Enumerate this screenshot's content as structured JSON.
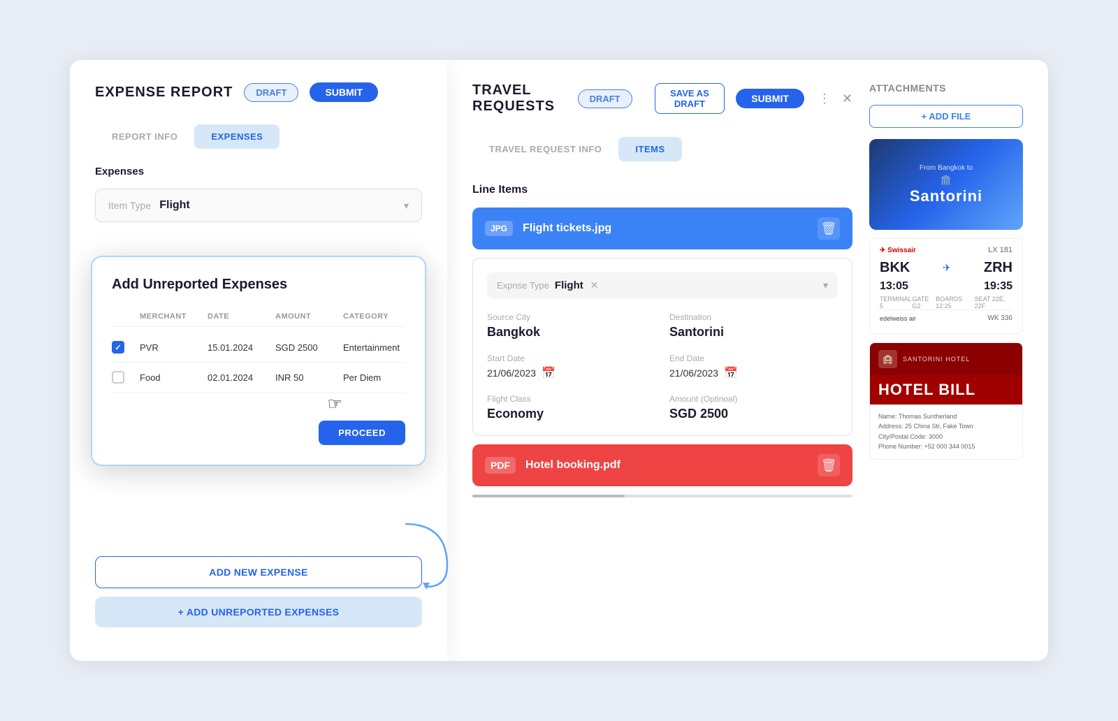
{
  "leftPanel": {
    "title": "EXPENSE REPORT",
    "draftLabel": "DRAFT",
    "submitLabel": "SUBMIT",
    "tabs": [
      {
        "id": "report-info",
        "label": "REPORT INFO"
      },
      {
        "id": "expenses",
        "label": "EXPENSES",
        "active": true
      }
    ],
    "sectionTitle": "Expenses",
    "itemTypeLabel": "Item Type",
    "itemTypeValue": "Flight",
    "popup": {
      "title": "Add Unreported Expenses",
      "columns": [
        "MERCHANT",
        "DATE",
        "AMOUNT",
        "CATEGORY"
      ],
      "rows": [
        {
          "checked": true,
          "merchant": "PVR",
          "date": "15.01.2024",
          "amount": "SGD 2500",
          "category": "Entertainment"
        },
        {
          "checked": false,
          "merchant": "Food",
          "date": "02.01.2024",
          "amount": "INR 50",
          "category": "Per Diem"
        }
      ],
      "proceedLabel": "PROCEED"
    },
    "addExpenseLabel": "ADD NEW EXPENSE",
    "addUnreportedLabel": "+ ADD UNREPORTED EXPENSES"
  },
  "rightPanel": {
    "title": "TRAVEL REQUESTS",
    "draftLabel": "DRAFT",
    "saveAsDraftLabel": "SAVE AS DRAFT",
    "submitLabel": "SUBMIT",
    "tabs": [
      {
        "id": "travel-request-info",
        "label": "TRAVEL REQUEST INFO"
      },
      {
        "id": "items",
        "label": "ITEMS",
        "active": true
      }
    ],
    "lineItemsTitle": "Line Items",
    "flightFile": {
      "badge": "JPG",
      "name": "Flight tickets.jpg"
    },
    "flightDetail": {
      "expenseTypeLabel": "Expnse Type",
      "expenseTypeValue": "Flight",
      "sourceCityLabel": "Source City",
      "sourceCityValue": "Bangkok",
      "destinationLabel": "Destination",
      "destinationValue": "Santorini",
      "startDateLabel": "Start Date",
      "startDateValue": "21/06/2023",
      "endDateLabel": "End Date",
      "endDateValue": "21/06/2023",
      "flightClassLabel": "Flight Class",
      "flightClassValue": "Economy",
      "amountLabel": "Amount (Optinoal)",
      "amountValue": "SGD 2500"
    },
    "hotelFile": {
      "badge": "PDF",
      "name": "Hotel booking.pdf"
    }
  },
  "attachments": {
    "title": "ATTACHMENTS",
    "addFileLabel": "+ ADD FILE",
    "ticket": {
      "airline": "Swissair",
      "flightNumber": "LX 181",
      "from": "BKK",
      "to": "ZRH",
      "departTime": "13:05",
      "arriveTime": "19:35",
      "terminal": "5",
      "gate": "G2",
      "boards": "12:25",
      "seat": "22E, 22F",
      "edelweiss": "edelweiss air",
      "wk": "WK 336"
    },
    "hotel": {
      "hotelName": "SANTORINI HOTEL",
      "billTitle": "HOTEL BILL",
      "lines": [
        "Name: Thomas Suntherland",
        "Address: 25 China Str, Fake Town",
        "City/Postal Code: 3000",
        "Phone Number: +52 000 344 0015"
      ]
    }
  }
}
